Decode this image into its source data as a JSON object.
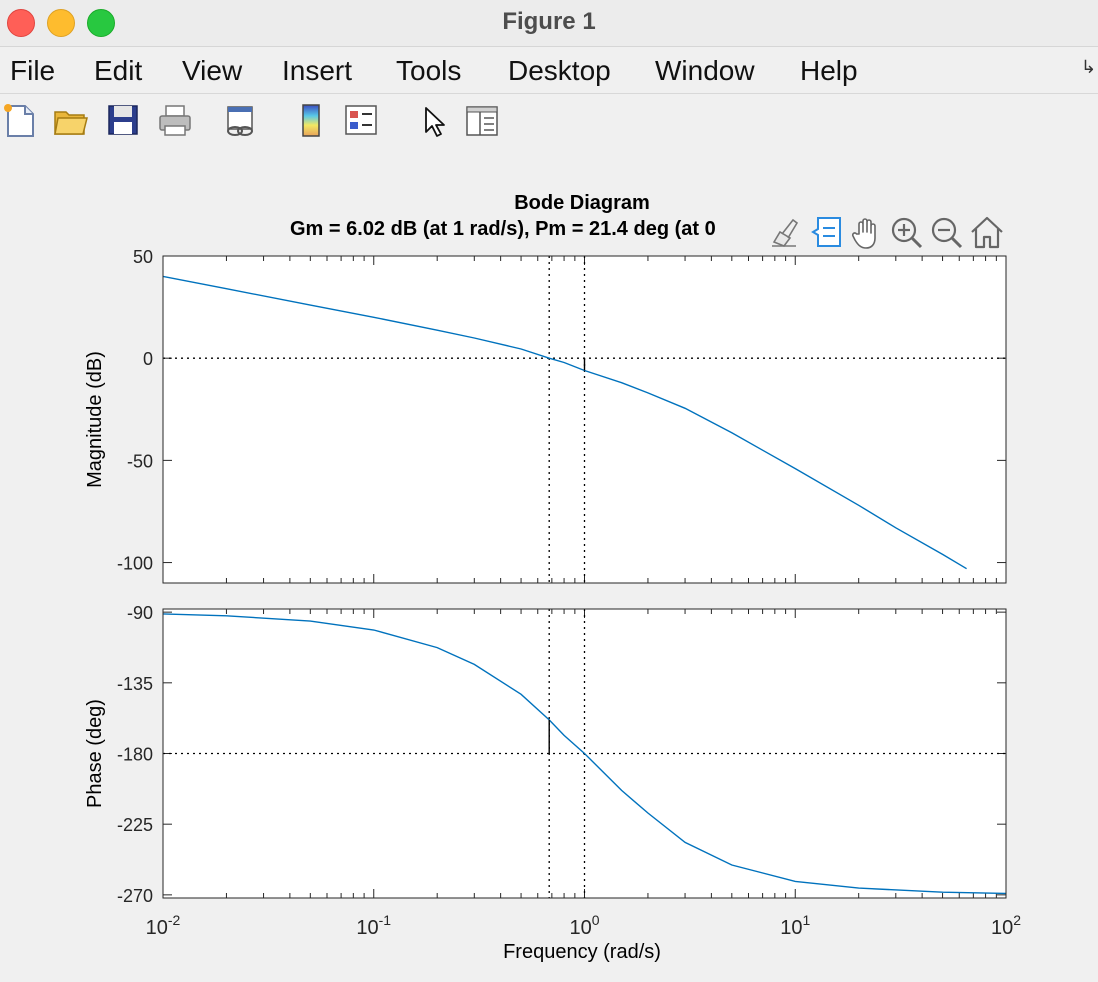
{
  "window": {
    "title": "Figure 1"
  },
  "menu": {
    "items": [
      "File",
      "Edit",
      "View",
      "Insert",
      "Tools",
      "Desktop",
      "Window",
      "Help"
    ],
    "overflow_icon": "menu-overflow-arrow-icon"
  },
  "toolbar": {
    "buttons": [
      {
        "name": "new-figure",
        "icon": "new-document-icon"
      },
      {
        "name": "open-file",
        "icon": "folder-open-icon"
      },
      {
        "name": "save-figure",
        "icon": "save-disk-icon"
      },
      {
        "name": "print-figure",
        "icon": "printer-icon"
      },
      {
        "name": "link-plot",
        "icon": "link-plot-icon"
      },
      {
        "name": "insert-colorbar",
        "icon": "colorbar-icon"
      },
      {
        "name": "insert-legend",
        "icon": "legend-icon"
      },
      {
        "name": "edit-plot",
        "icon": "pointer-arrow-icon"
      },
      {
        "name": "property-inspector",
        "icon": "property-inspector-icon"
      }
    ]
  },
  "axes_toolbar": {
    "buttons": [
      {
        "name": "brush",
        "icon": "brush-icon"
      },
      {
        "name": "data-tips",
        "icon": "data-tips-icon"
      },
      {
        "name": "pan",
        "icon": "pan-hand-icon"
      },
      {
        "name": "zoom-in",
        "icon": "zoom-in-icon"
      },
      {
        "name": "zoom-out",
        "icon": "zoom-out-icon"
      },
      {
        "name": "restore-view",
        "icon": "home-icon"
      }
    ]
  },
  "colors": {
    "curve": "#0072bd",
    "axes_bg": "#ffffff",
    "figure_bg": "#f0f0f0",
    "margin_line": "#000000"
  },
  "chart_data": {
    "type": "line",
    "title": "Bode Diagram",
    "subtitle": "Gm = 6.02 dB (at 1 rad/s),  Pm = 21.4 deg (at 0",
    "xlabel": "Frequency  (rad/s)",
    "x_scale": "log",
    "xlim": [
      0.01,
      100
    ],
    "x_ticks": [
      0.01,
      0.1,
      1,
      10,
      100
    ],
    "x_tick_labels": [
      {
        "base": "10",
        "exp": "-2"
      },
      {
        "base": "10",
        "exp": "-1"
      },
      {
        "base": "10",
        "exp": "0"
      },
      {
        "base": "10",
        "exp": "1"
      },
      {
        "base": "10",
        "exp": "2"
      }
    ],
    "grid": false,
    "margins": {
      "gain_margin_db": 6.02,
      "gain_crossover_freq": 1,
      "phase_margin_deg": 21.4,
      "phase_crossover_freq": 0.68
    },
    "subplots": [
      {
        "name": "magnitude",
        "ylabel": "Magnitude (dB)",
        "ylim": [
          -110,
          50
        ],
        "y_ticks": [
          50,
          0,
          -50,
          -100
        ],
        "y_tick_labels": [
          "50",
          "0",
          "-50",
          "-100"
        ],
        "reference_line": 0,
        "series": [
          {
            "x": [
              0.01,
              0.02,
              0.05,
              0.1,
              0.2,
              0.3,
              0.5,
              0.68,
              0.8,
              1,
              1.5,
              2,
              3,
              5,
              7,
              10,
              20,
              30,
              50,
              65
            ],
            "y": [
              40,
              34,
              26,
              20,
              13.7,
              9.9,
              4.5,
              0,
              -2.1,
              -6.02,
              -12,
              -17,
              -24.5,
              -36.5,
              -45,
              -54,
              -72,
              -83,
              -96,
              -103
            ]
          }
        ]
      },
      {
        "name": "phase",
        "ylabel": "Phase (deg)",
        "ylim": [
          -272,
          -88
        ],
        "y_ticks": [
          -90,
          -135,
          -180,
          -225,
          -270
        ],
        "y_tick_labels": [
          "-90",
          "-135",
          "-180",
          "-225",
          "-270"
        ],
        "reference_line": -180,
        "series": [
          {
            "x": [
              0.01,
              0.02,
              0.05,
              0.1,
              0.2,
              0.3,
              0.5,
              0.68,
              0.8,
              1,
              1.5,
              2,
              3,
              5,
              10,
              20,
              50,
              100
            ],
            "y": [
              -91.1,
              -92.3,
              -95.7,
              -101.4,
              -112.6,
              -123.3,
              -142.3,
              -158.6,
              -168.5,
              -180,
              -203.5,
              -217.9,
              -236.6,
              -251,
              -261.4,
              -265.7,
              -268.3,
              -269.1
            ]
          }
        ]
      }
    ]
  }
}
